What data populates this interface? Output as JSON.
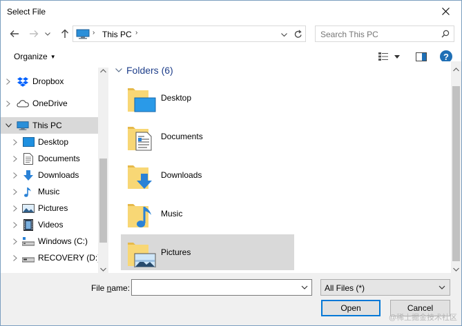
{
  "window": {
    "title": "Select File"
  },
  "address_bar": {
    "location": "This PC"
  },
  "search": {
    "placeholder": "Search This PC"
  },
  "command_bar": {
    "organize_label": "Organize"
  },
  "nav_pane": {
    "items": [
      {
        "label": "Dropbox",
        "icon": "dropbox-icon"
      },
      {
        "label": "OneDrive",
        "icon": "onedrive-icon"
      },
      {
        "label": "This PC",
        "icon": "this-pc-icon",
        "selected": true,
        "expanded": true
      },
      {
        "label": "Desktop",
        "icon": "desktop-icon"
      },
      {
        "label": "Documents",
        "icon": "documents-icon"
      },
      {
        "label": "Downloads",
        "icon": "downloads-icon"
      },
      {
        "label": "Music",
        "icon": "music-icon"
      },
      {
        "label": "Pictures",
        "icon": "pictures-icon"
      },
      {
        "label": "Videos",
        "icon": "videos-icon"
      },
      {
        "label": "Windows (C:)",
        "icon": "drive-c-icon"
      },
      {
        "label": "RECOVERY (D:)",
        "icon": "drive-d-icon"
      }
    ]
  },
  "content": {
    "group_header": "Folders (6)",
    "folders": [
      {
        "label": "Desktop",
        "icon": "desktop-folder-icon"
      },
      {
        "label": "Documents",
        "icon": "documents-folder-icon"
      },
      {
        "label": "Downloads",
        "icon": "downloads-folder-icon"
      },
      {
        "label": "Music",
        "icon": "music-folder-icon"
      },
      {
        "label": "Pictures",
        "icon": "pictures-folder-icon",
        "hovered": true
      }
    ]
  },
  "footer": {
    "file_name_label_prefix": "File ",
    "file_name_label_accel": "n",
    "file_name_label_suffix": "ame:",
    "file_name_value": "",
    "file_type": "All Files (*)",
    "open_label": "Open",
    "cancel_label": "Cancel",
    "watermark": "@稀土掘金技术社区"
  },
  "colors": {
    "accent": "#0078d7",
    "selected_bg": "#d9d9d9",
    "group_header": "#1e3e8a",
    "folder_yellow": "#f8d775"
  }
}
